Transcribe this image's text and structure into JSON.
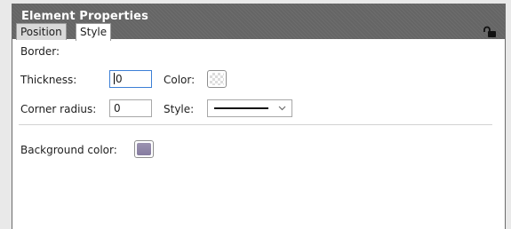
{
  "panel": {
    "title": "Element Properties",
    "tabs": [
      {
        "label": "Position",
        "active": false
      },
      {
        "label": "Style",
        "active": true
      }
    ]
  },
  "border": {
    "section_label": "Border:",
    "thickness_label": "Thickness:",
    "thickness_value": "0",
    "color_label": "Color:",
    "color_value": "transparent",
    "corner_radius_label": "Corner radius:",
    "corner_radius_value": "0",
    "style_label": "Style:",
    "style_value": "solid"
  },
  "background": {
    "color_label": "Background color:",
    "color_value": "#8f86a8"
  },
  "icons": {
    "lock": "unlock-icon",
    "dropdown": "chevron-down-icon"
  }
}
